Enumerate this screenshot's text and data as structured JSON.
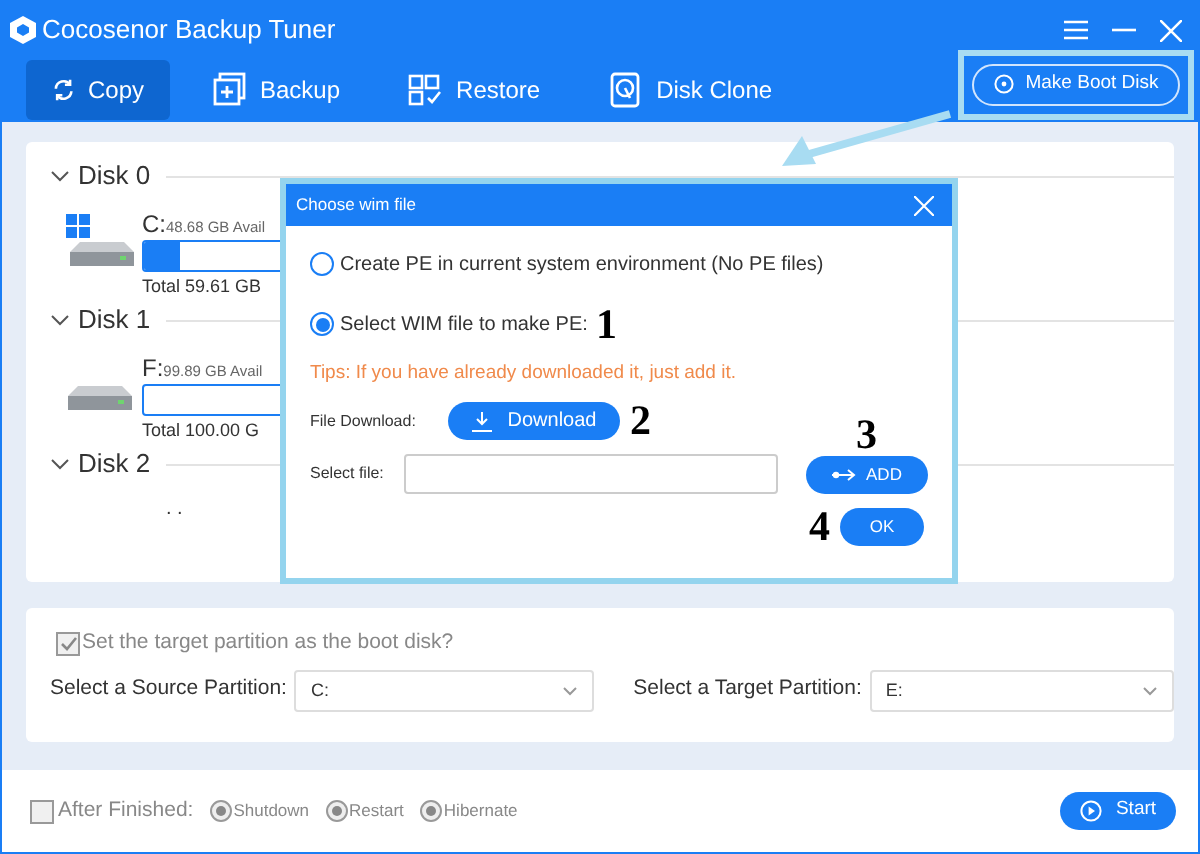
{
  "window": {
    "title": "Cocosenor Backup Tuner"
  },
  "tabs": [
    {
      "label": "Copy",
      "selected": true
    },
    {
      "label": "Backup",
      "selected": false
    },
    {
      "label": "Restore",
      "selected": false
    },
    {
      "label": "Disk Clone",
      "selected": false
    }
  ],
  "boot_button": {
    "label": "Make Boot Disk"
  },
  "disks": [
    {
      "title": "Disk 0",
      "expanded": true,
      "partitions": [
        {
          "letter": "C:",
          "avail": "48.68 GB Avail",
          "total": "Total 59.61 GB",
          "system": true,
          "level": 0.15
        }
      ]
    },
    {
      "title": "Disk 1",
      "expanded": true,
      "partitions": [
        {
          "letter": "F:",
          "avail": "99.89 GB Avail",
          "total": "Total 100.00 G",
          "system": false,
          "level": 0
        }
      ]
    },
    {
      "title": "Disk 2",
      "expanded": true,
      "note": ". ."
    }
  ],
  "dialog": {
    "title": "Choose wim file",
    "options": [
      {
        "label": "Create PE in current system environment (No PE files)",
        "selected": false
      },
      {
        "label": "Select WIM file to make PE:",
        "selected": true
      }
    ],
    "tip": "Tips: If you have already downloaded it, just add it.",
    "download_label": "File Download:",
    "download_button": "Download",
    "file_label": "Select file:",
    "add_button": "ADD",
    "ok_button": "OK",
    "markers": [
      "1",
      "2",
      "3",
      "4"
    ]
  },
  "boot_option": {
    "label": "Set the target partition as the boot disk?",
    "checked": true,
    "disabled": true
  },
  "source": {
    "label": "Select a Source Partition:",
    "value": "C:"
  },
  "target": {
    "label": "Select a Target Partition:",
    "value": "E:"
  },
  "after": {
    "label": "After Finished:",
    "checked": false,
    "options": [
      {
        "label": "Shutdown",
        "selected": true,
        "disabled": true
      },
      {
        "label": "Restart",
        "selected": true,
        "disabled": true
      },
      {
        "label": "Hibernate",
        "selected": true,
        "disabled": true
      }
    ]
  },
  "start_button": "Start"
}
